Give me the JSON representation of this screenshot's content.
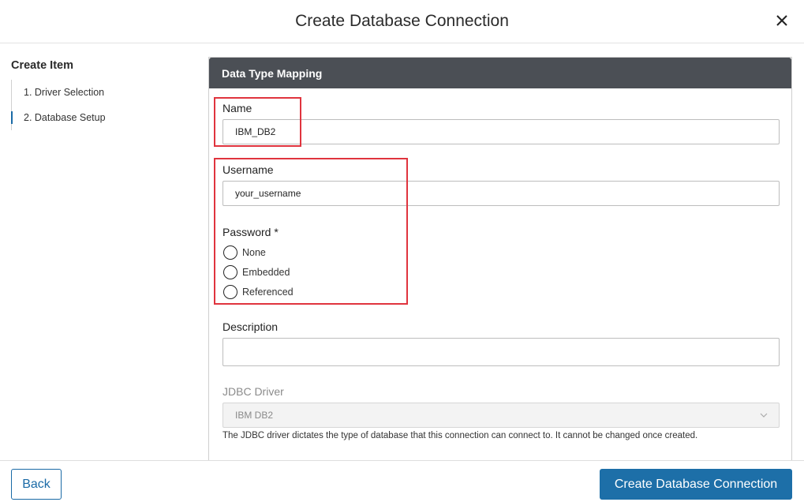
{
  "header": {
    "title": "Create Database Connection",
    "close_icon": "close-icon"
  },
  "sidebar": {
    "title": "Create Item",
    "steps": [
      {
        "label": "1. Driver Selection",
        "active": false
      },
      {
        "label": "2. Database Setup",
        "active": true
      }
    ]
  },
  "panel": {
    "title": "Data Type Mapping",
    "name": {
      "label": "Name",
      "value": "IBM_DB2"
    },
    "username": {
      "label": "Username",
      "value": "your_username"
    },
    "password": {
      "label": "Password *",
      "options": [
        "None",
        "Embedded",
        "Referenced"
      ],
      "selected": null
    },
    "description": {
      "label": "Description",
      "value": ""
    },
    "jdbc": {
      "label": "JDBC Driver",
      "value": "IBM DB2",
      "help": "The JDBC driver dictates the type of database that this connection can connect to. It cannot be changed once created."
    }
  },
  "footer": {
    "back_label": "Back",
    "create_label": "Create Database Connection"
  },
  "colors": {
    "primary": "#1d6fa8",
    "header_bar": "#4b4f55",
    "highlight": "#e0343e"
  }
}
